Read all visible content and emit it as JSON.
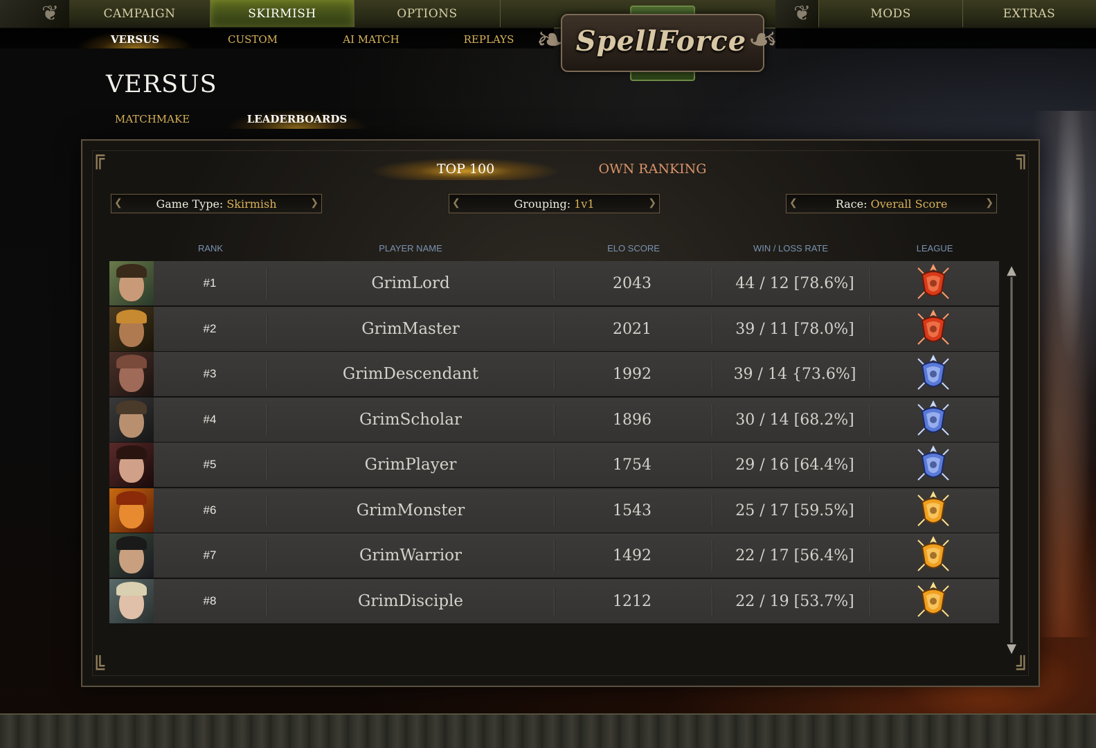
{
  "nav": {
    "tabs": [
      {
        "label": "CAMPAIGN",
        "active": false
      },
      {
        "label": "SKIRMISH",
        "active": true
      },
      {
        "label": "OPTIONS",
        "active": false
      },
      {
        "label": "MODS",
        "active": false
      },
      {
        "label": "EXTRAS",
        "active": false
      }
    ],
    "subtabs": [
      {
        "label": "VERSUS",
        "active": true
      },
      {
        "label": "CUSTOM",
        "active": false
      },
      {
        "label": "AI MATCH",
        "active": false
      },
      {
        "label": "REPLAYS",
        "active": false
      }
    ]
  },
  "logo": {
    "text": "SpellForce"
  },
  "page": {
    "title": "VERSUS",
    "tabs": [
      {
        "label": "MATCHMAKE",
        "active": false
      },
      {
        "label": "LEADERBOARDS",
        "active": true
      }
    ]
  },
  "leaderboard": {
    "tabs": [
      {
        "label": "TOP 100",
        "active": true
      },
      {
        "label": "OWN RANKING",
        "active": false
      }
    ],
    "filters": {
      "game_type": {
        "label": "Game Type:",
        "value": "Skirmish"
      },
      "grouping": {
        "label": "Grouping:",
        "value": "1v1"
      },
      "race": {
        "label": "Race:",
        "value": "Overall Score"
      }
    },
    "columns": {
      "rank": "RANK",
      "player_name": "PLAYER NAME",
      "elo_score": "ELO SCORE",
      "win_loss": "WIN / LOSS RATE",
      "league": "LEAGUE"
    },
    "rows": [
      {
        "rank": "#1",
        "name": "GrimLord",
        "elo": "2043",
        "winloss": "44 / 12 [78.6%]",
        "league": "red",
        "avatar": "human-mustache"
      },
      {
        "rank": "#2",
        "name": "GrimMaster",
        "elo": "2021",
        "winloss": "39 / 11 [78.0%]",
        "league": "red",
        "avatar": "dwarf-pipe"
      },
      {
        "rank": "#3",
        "name": "GrimDescendant",
        "elo": "1992",
        "winloss": "39 / 14 {73.6%]",
        "league": "blue",
        "avatar": "dwarf-bald"
      },
      {
        "rank": "#4",
        "name": "GrimScholar",
        "elo": "1896",
        "winloss": "30 / 14 [68.2%]",
        "league": "blue",
        "avatar": "bearded-man"
      },
      {
        "rank": "#5",
        "name": "GrimPlayer",
        "elo": "1754",
        "winloss": "29 / 16 [64.4%]",
        "league": "blue",
        "avatar": "dark-haired-woman"
      },
      {
        "rank": "#6",
        "name": "GrimMonster",
        "elo": "1543",
        "winloss": "25 / 17 [59.5%]",
        "league": "gold",
        "avatar": "fire-dragon"
      },
      {
        "rank": "#7",
        "name": "GrimWarrior",
        "elo": "1492",
        "winloss": "22 / 17 [56.4%]",
        "league": "gold",
        "avatar": "asian-warrior"
      },
      {
        "rank": "#8",
        "name": "GrimDisciple",
        "elo": "1212",
        "winloss": "22 / 19 [53.7%]",
        "league": "gold",
        "avatar": "elf-woman"
      }
    ]
  },
  "colors": {
    "accent_gold": "#d9b35a",
    "active_nav_green": "#5e6a1c",
    "league_red": "#d83a1a",
    "league_blue": "#5a7ad8",
    "league_gold": "#f0a020",
    "header_blue": "#7a93b0"
  },
  "icons": {
    "scroll_up": "arrow-up-icon",
    "scroll_down": "arrow-down-icon"
  }
}
